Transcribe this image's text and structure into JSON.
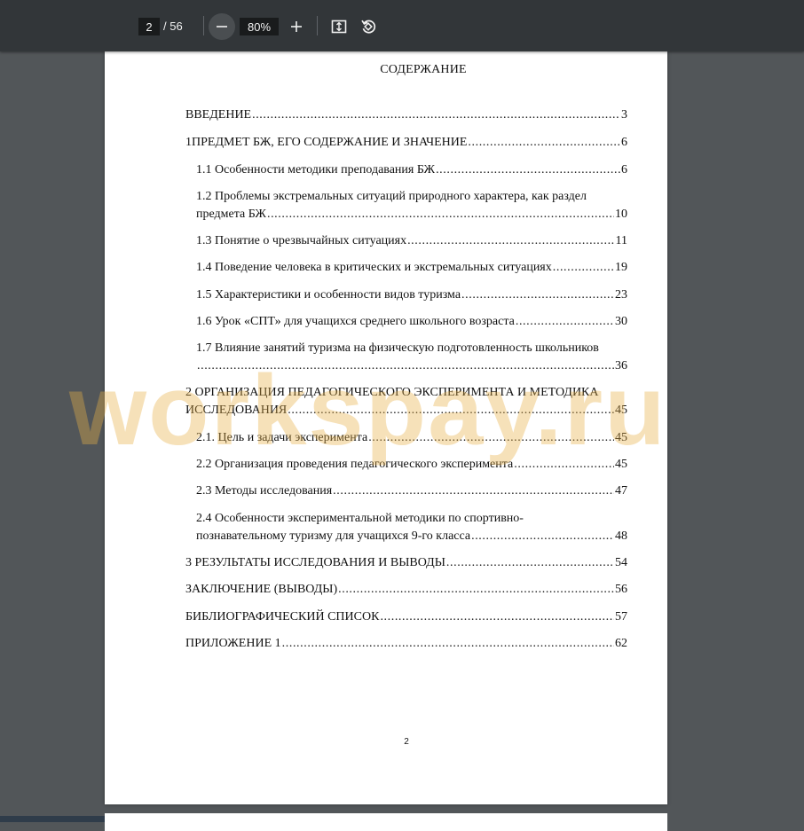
{
  "toolbar": {
    "page_current": "2",
    "page_total": "/ 56",
    "zoom": "80%",
    "icons": [
      "zoom-out-icon",
      "zoom-in-icon",
      "fit-page-icon",
      "rotate-icon"
    ]
  },
  "document": {
    "title": "СОДЕРЖАНИЕ",
    "entries": [
      {
        "text": "ВВЕДЕНИЕ",
        "page": "3"
      },
      {
        "text": "1ПРЕДМЕТ БЖ, ЕГО СОДЕРЖАНИЕ И ЗНАЧЕНИЕ",
        "page": "6"
      },
      {
        "text": "1.1 Особенности методики преподавания БЖ",
        "page": "6"
      },
      {
        "line1": "1.2 Проблемы экстремальных ситуаций природного характера, как раздел",
        "text": "предмета БЖ",
        "page": "10"
      },
      {
        "text": "1.3 Понятие о чрезвычайных ситуациях",
        "page": "11"
      },
      {
        "text": "1.4 Поведение человека в критических и экстремальных ситуациях",
        "page": "19"
      },
      {
        "text": "1.5 Характеристики и особенности видов туризма",
        "page": "23"
      },
      {
        "text": "1.6 Урок «СПТ» для учащихся среднего школьного возраста",
        "page": "30"
      },
      {
        "line1": "1.7 Влияние занятий туризма на физическую подготовленность школьников",
        "text": "",
        "page": "36"
      },
      {
        "line1": "2 ОРГАНИЗАЦИЯ ПЕДАГОГИЧЕСКОГО ЭКСПЕРИМЕНТА И МЕТОДИКА",
        "text": "ИССЛЕДОВАНИЯ",
        "page": "45"
      },
      {
        "text": "2.1. Цель и задачи эксперимента",
        "page": "45"
      },
      {
        "text": "2.2 Организация проведения педагогического эксперимента",
        "page": "45"
      },
      {
        "text": "2.3 Методы исследования",
        "page": "47"
      },
      {
        "line1": "2.4 Особенности экспериментальной методики по спортивно-",
        "text": "познавательному туризму для учащихся 9-го класса",
        "page": "48"
      },
      {
        "text": "3 РЕЗУЛЬТАТЫ ИССЛЕДОВАНИЯ И ВЫВОДЫ",
        "page": "54"
      },
      {
        "text": "ЗАКЛЮЧЕНИЕ (ВЫВОДЫ)",
        "page": "56"
      },
      {
        "text": "БИБЛИОГРАФИЧЕСКИЙ СПИСОК",
        "page": "57"
      },
      {
        "text": "ПРИЛОЖЕНИЕ 1",
        "page": "62"
      }
    ],
    "page_number": "2"
  },
  "watermark": "workspay.ru"
}
